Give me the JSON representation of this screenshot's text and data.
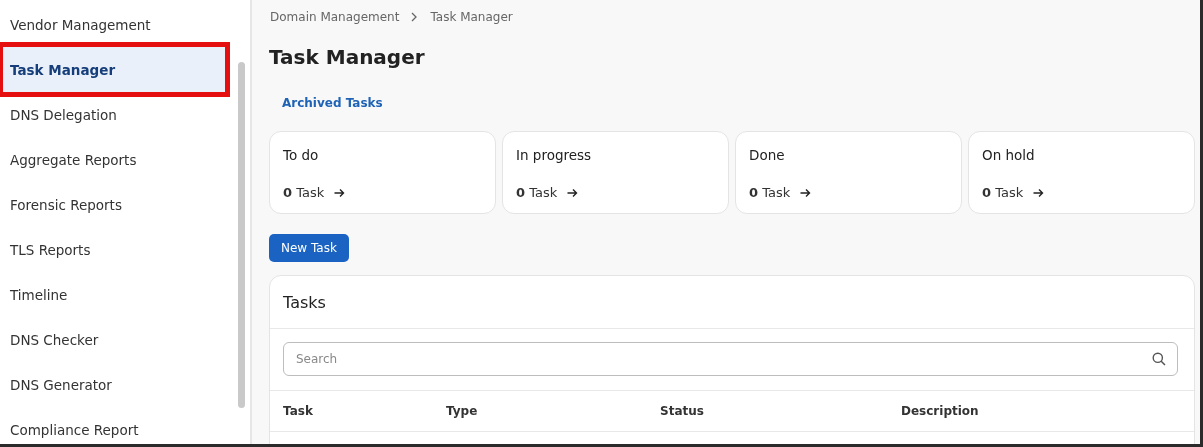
{
  "sidebar": {
    "items": [
      {
        "label": "Vendor Management",
        "selected": false,
        "highlighted": false
      },
      {
        "label": "Task Manager",
        "selected": true,
        "highlighted": true
      },
      {
        "label": "DNS Delegation",
        "selected": false,
        "highlighted": false
      },
      {
        "label": "Aggregate Reports",
        "selected": false,
        "highlighted": false
      },
      {
        "label": "Forensic Reports",
        "selected": false,
        "highlighted": false
      },
      {
        "label": "TLS Reports",
        "selected": false,
        "highlighted": false
      },
      {
        "label": "Timeline",
        "selected": false,
        "highlighted": false
      },
      {
        "label": "DNS Checker",
        "selected": false,
        "highlighted": false
      },
      {
        "label": "DNS Generator",
        "selected": false,
        "highlighted": false
      },
      {
        "label": "Compliance Report",
        "selected": false,
        "highlighted": false
      }
    ]
  },
  "breadcrumb": [
    "Domain Management",
    "Task Manager"
  ],
  "title": "Task Manager",
  "archived_link": "Archived Tasks",
  "status_cards": [
    {
      "label": "To do",
      "count": "0",
      "unit": "Task"
    },
    {
      "label": "In progress",
      "count": "0",
      "unit": "Task"
    },
    {
      "label": "Done",
      "count": "0",
      "unit": "Task"
    },
    {
      "label": "On hold",
      "count": "0",
      "unit": "Task"
    }
  ],
  "new_task_button": "New Task",
  "tasks_panel": {
    "title": "Tasks",
    "search": {
      "placeholder": "Search"
    },
    "columns": [
      "Task",
      "Type",
      "Status",
      "Description"
    ]
  }
}
